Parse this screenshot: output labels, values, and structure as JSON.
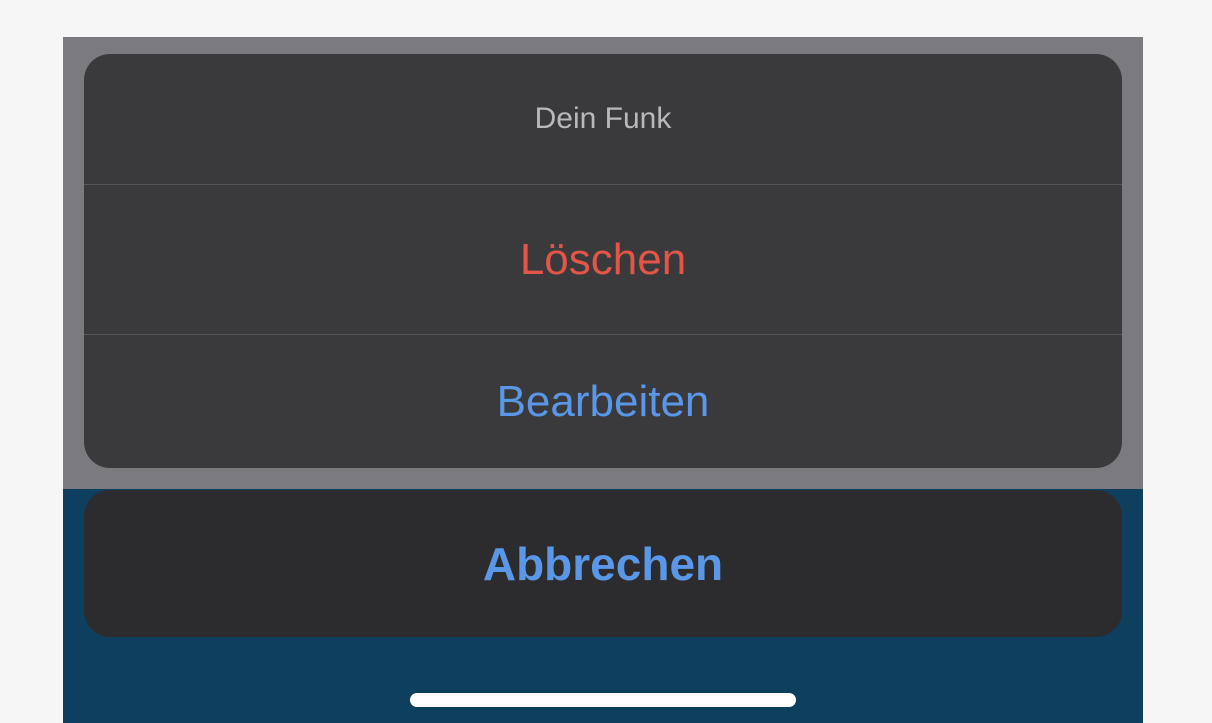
{
  "action_sheet": {
    "title": "Dein Funk",
    "actions": [
      {
        "label": "Löschen",
        "color": "#e25547"
      },
      {
        "label": "Bearbeiten",
        "color": "#5a97e6"
      }
    ],
    "cancel_label": "Abbrechen"
  },
  "colors": {
    "sheet_background": "#3a3a3c",
    "cancel_background": "#2c2c2e",
    "bottom_band": "#0e3f5f",
    "dim_overlay": "#7b7b7f"
  }
}
